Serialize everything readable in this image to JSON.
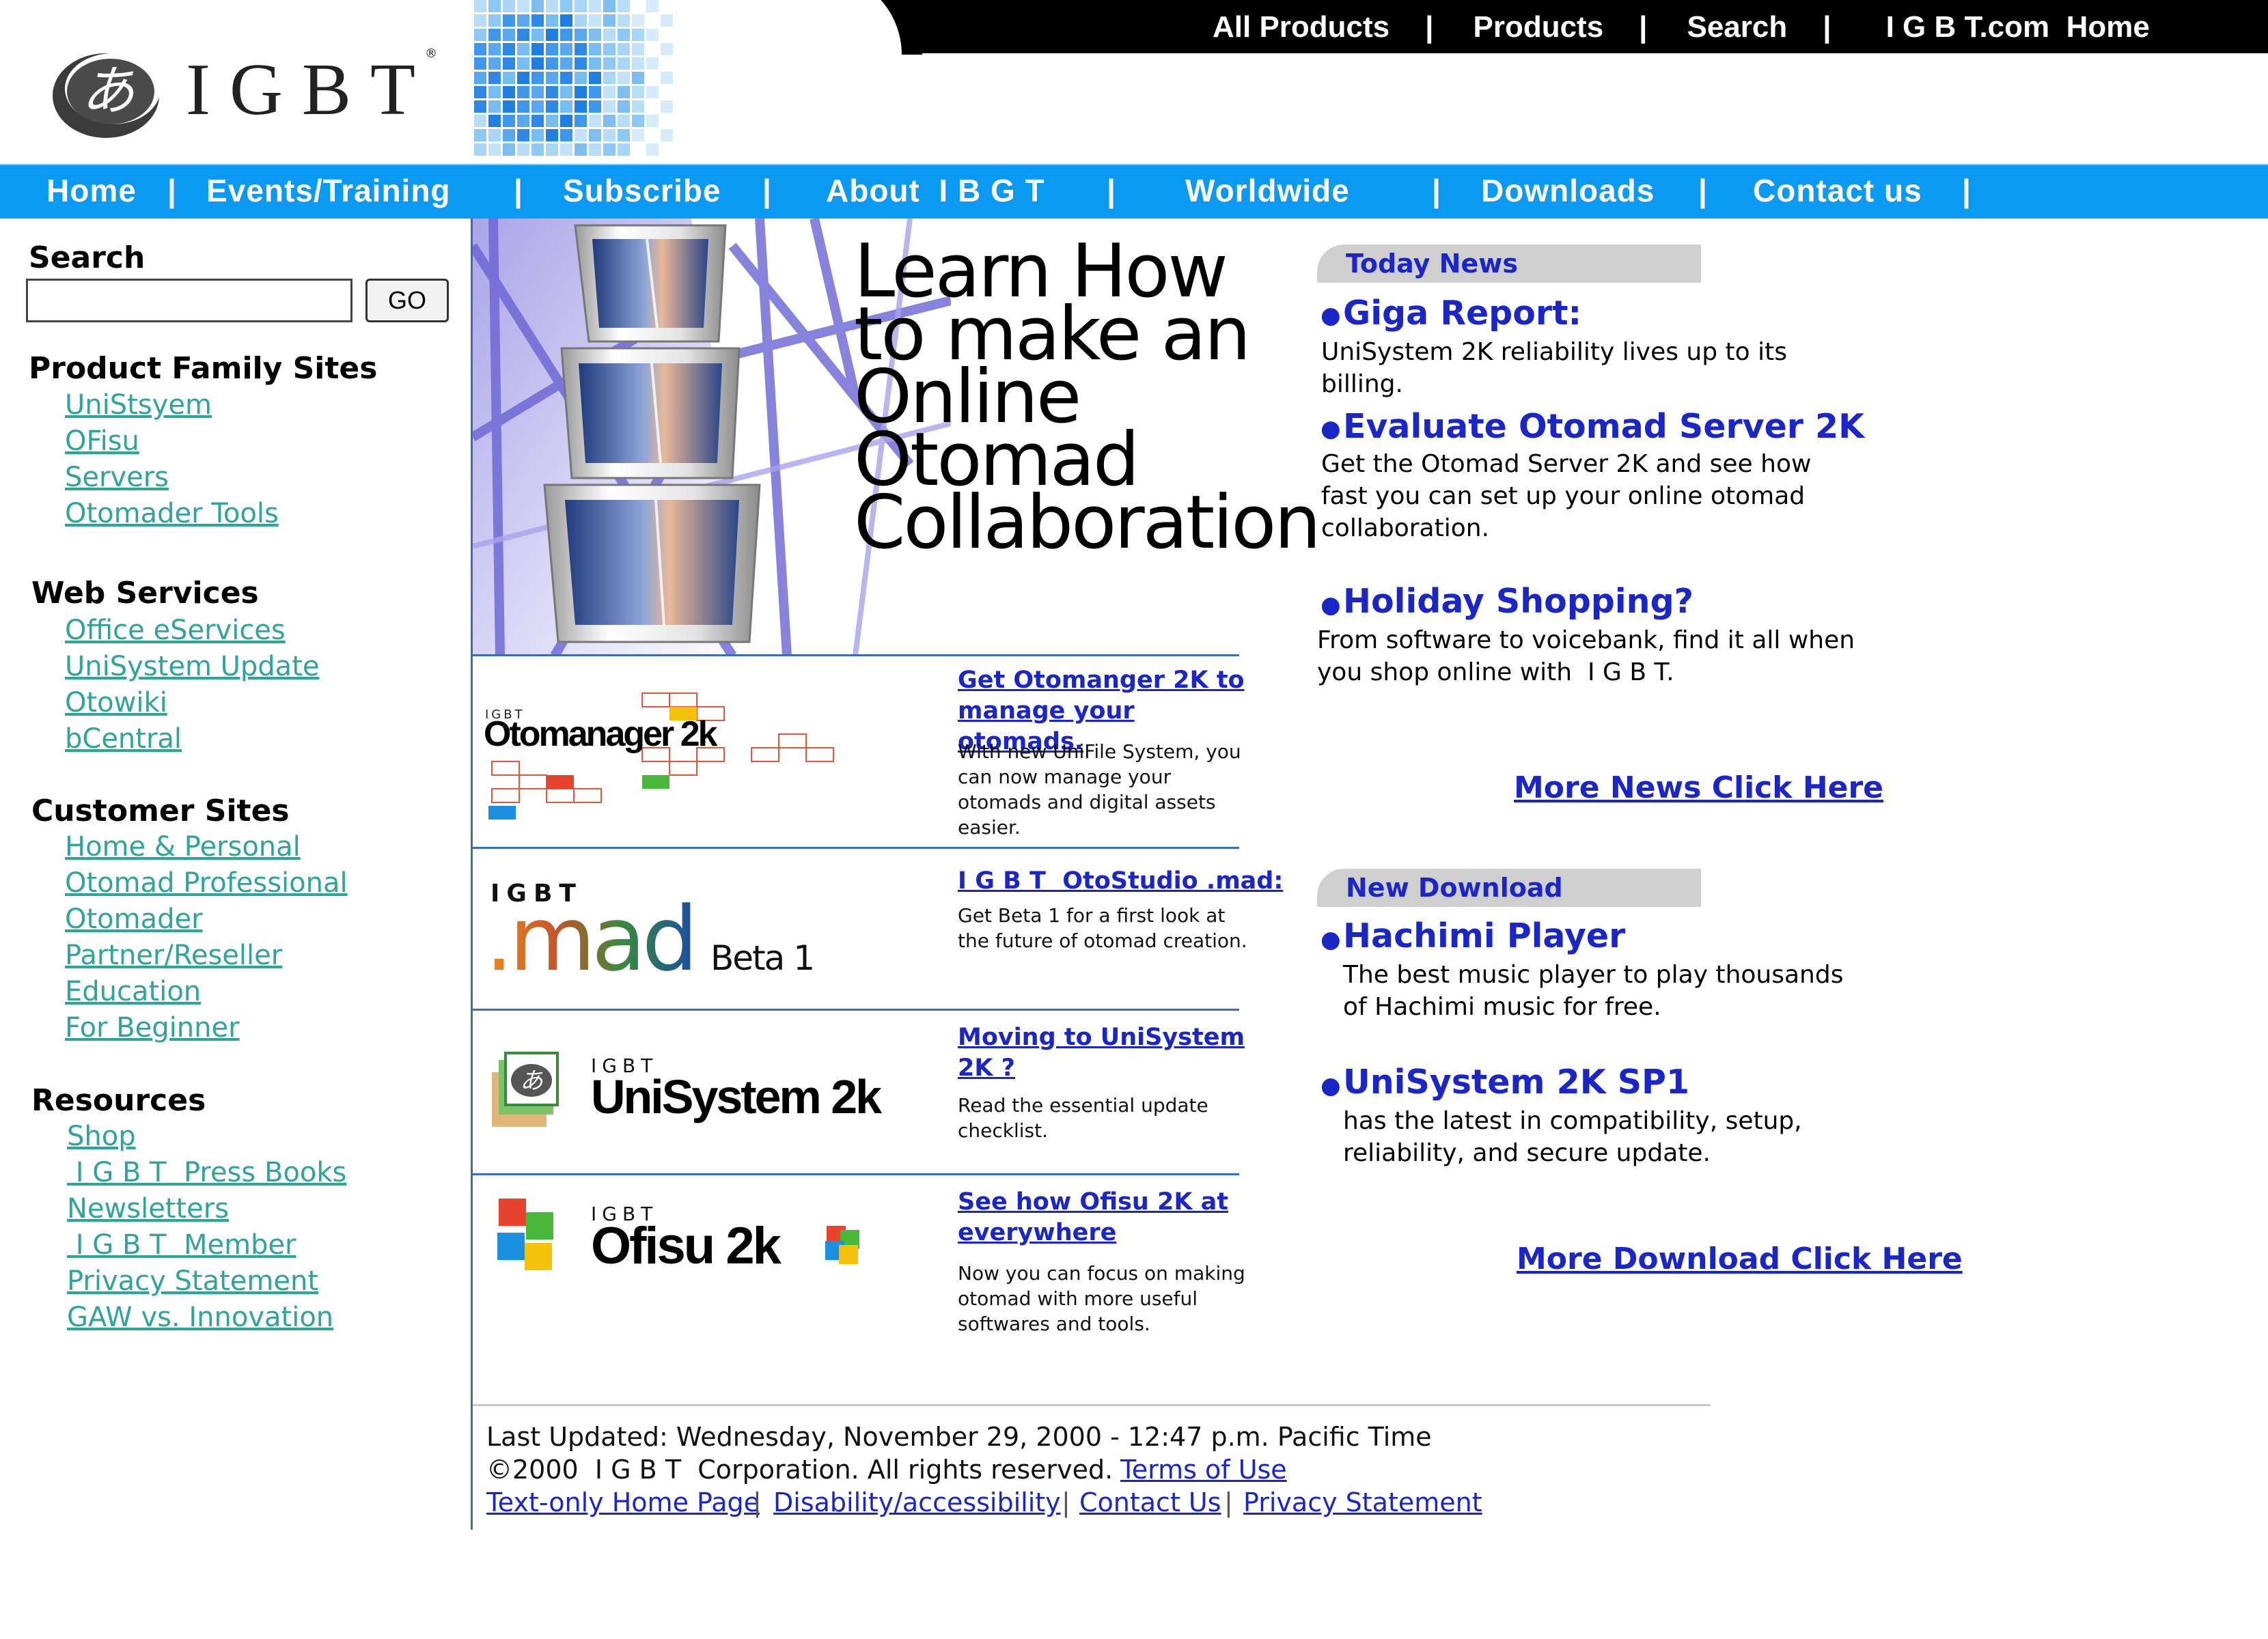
{
  "top_nav": {
    "all_products": "All Products",
    "products": "Products",
    "search": "Search",
    "home": "I G B T.com  Home",
    "separator": "|"
  },
  "logo": {
    "mark": "あ",
    "name": "IGBT",
    "registered": "®"
  },
  "main_nav": {
    "items": [
      "Home",
      "Events/Training",
      "Subscribe",
      "About  I B G T",
      "Worldwide",
      "Downloads",
      "Contact us"
    ],
    "separator": "|"
  },
  "sidebar": {
    "search_label": "Search",
    "search_value": "",
    "go_label": "GO",
    "sections": [
      {
        "heading": "Product Family Sites",
        "links": [
          "UniStsyem",
          "OFisu",
          "Servers",
          "Otomader Tools"
        ]
      },
      {
        "heading": "Web Services",
        "links": [
          "Office eServices",
          "UniSystem Update",
          "Otowiki",
          "bCentral"
        ]
      },
      {
        "heading": "Customer Sites",
        "links": [
          "Home & Personal",
          "Otomad Professional",
          "Otomader",
          "Partner/Reseller",
          "Education",
          "For Beginner"
        ]
      },
      {
        "heading": "Resources",
        "links": [
          "Shop",
          " I G B T  Press Books",
          "Newsletters",
          " I G B T  Member",
          "Privacy Statement",
          "GAW vs. Innovation"
        ]
      }
    ]
  },
  "hero": {
    "lines": [
      "Learn How",
      "to make an",
      "Online",
      "Otomad",
      "Collaboration"
    ]
  },
  "promos": [
    {
      "logo": "Otomanager 2k",
      "logo_small": "IGBT",
      "title": "Get Otomanger 2K to manage your otomads.",
      "desc": "With new UniFile System, you can now manage your otomads and digital assets easier."
    },
    {
      "logo": ".mad",
      "logo_small": "IGBT",
      "logo_extra": "Beta 1",
      "title": "I G B T  OtoStudio .mad:",
      "desc": "Get Beta 1 for a first look at the future of otomad creation."
    },
    {
      "logo": "UniSystem 2k",
      "logo_small": "IGBT",
      "title": "Moving to UniSystem 2K ?",
      "desc": "Read the essential update checklist."
    },
    {
      "logo": "Ofisu 2k",
      "logo_small": "IGBT",
      "title": "See how Ofisu 2K at everywhere",
      "desc": "Now you can focus on making otomad with more useful softwares and tools."
    }
  ],
  "today_news": {
    "tab": "Today News",
    "items": [
      {
        "title": "Giga Report:",
        "desc": "UniSystem 2K reliability lives up to its billing."
      },
      {
        "title": "Evaluate Otomad Server 2K",
        "desc": "Get the Otomad Server 2K and see how fast you can set up your online otomad collaboration."
      },
      {
        "title": "Holiday Shopping?",
        "desc": "From software to voicebank, find it all when you shop online with  I G B T."
      }
    ],
    "more": "More News Click Here"
  },
  "new_download": {
    "tab": "New Download",
    "items": [
      {
        "title": "Hachimi Player",
        "desc": "The best music player to play thousands of Hachimi music for free."
      },
      {
        "title": "UniSystem 2K SP1",
        "desc": "has the latest in compatibility, setup, reliability, and secure update."
      }
    ],
    "more": "More Download Click Here"
  },
  "footer": {
    "updated": "Last Updated: Wednesday, November 29, 2000 - 12:47 p.m. Pacific Time",
    "copyright": "©2000  I G B T  Corporation. All rights reserved.",
    "terms": "Terms of Use",
    "links": [
      "Text-only Home Page",
      "Disability/accessibility",
      "Contact Us",
      "Privacy Statement"
    ],
    "separator": "|"
  },
  "colors": {
    "nav_blue": "#0b9af3",
    "link_teal": "#2fa59a",
    "link_blue": "#1a26c8"
  }
}
